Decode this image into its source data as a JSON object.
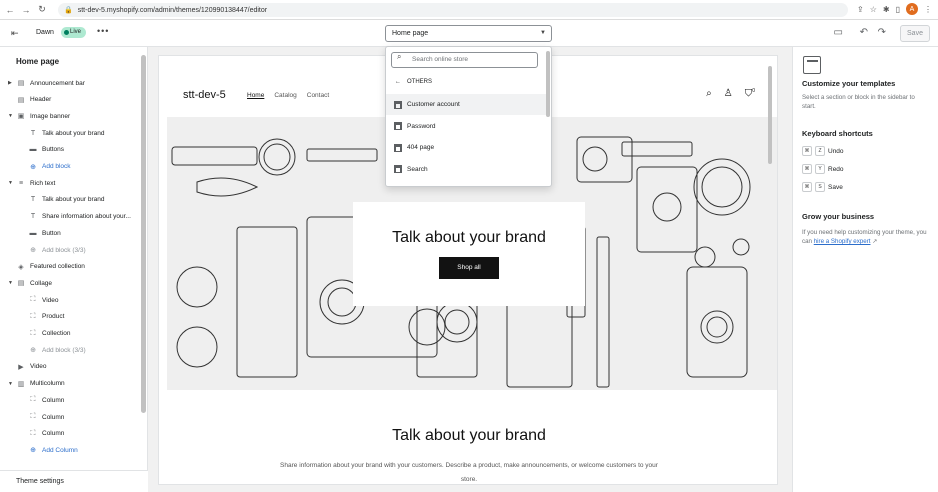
{
  "browser": {
    "url": "stt-dev-5.myshopify.com/admin/themes/120990138447/editor",
    "profile_initial": "A"
  },
  "toolbar": {
    "theme_name": "Dawn",
    "live_label": "Live",
    "page_selector": "Home page",
    "save_label": "Save"
  },
  "sidebar": {
    "title": "Home page",
    "items": [
      {
        "label": "Announcement bar",
        "icon": "section-icon",
        "level": 0,
        "arrow": "▶",
        "kind": "section"
      },
      {
        "label": "Header",
        "icon": "section-icon",
        "level": 0,
        "arrow": "",
        "kind": "section"
      },
      {
        "label": "Image banner",
        "icon": "image-icon",
        "level": 0,
        "arrow": "▼",
        "kind": "section"
      },
      {
        "label": "Talk about your brand",
        "icon": "text-icon",
        "level": 1,
        "arrow": "",
        "kind": "block"
      },
      {
        "label": "Buttons",
        "icon": "buttons-icon",
        "level": 1,
        "arrow": "",
        "kind": "block"
      },
      {
        "label": "Add block",
        "icon": "plus-icon",
        "level": 1,
        "arrow": "",
        "kind": "add"
      },
      {
        "label": "Rich text",
        "icon": "richtext-icon",
        "level": 0,
        "arrow": "▼",
        "kind": "section"
      },
      {
        "label": "Talk about your brand",
        "icon": "text-icon",
        "level": 1,
        "arrow": "",
        "kind": "block"
      },
      {
        "label": "Share information about your...",
        "icon": "text-icon",
        "level": 1,
        "arrow": "",
        "kind": "block"
      },
      {
        "label": "Button",
        "icon": "buttons-icon",
        "level": 1,
        "arrow": "",
        "kind": "block"
      },
      {
        "label": "Add block (3/3)",
        "icon": "plus-icon",
        "level": 1,
        "arrow": "",
        "kind": "disabled"
      },
      {
        "label": "Featured collection",
        "icon": "tag-icon",
        "level": 0,
        "arrow": "",
        "kind": "section"
      },
      {
        "label": "Collage",
        "icon": "section-icon",
        "level": 0,
        "arrow": "▼",
        "kind": "section"
      },
      {
        "label": "Video",
        "icon": "frame-icon",
        "level": 1,
        "arrow": "",
        "kind": "block"
      },
      {
        "label": "Product",
        "icon": "frame-icon",
        "level": 1,
        "arrow": "",
        "kind": "block"
      },
      {
        "label": "Collection",
        "icon": "frame-icon",
        "level": 1,
        "arrow": "",
        "kind": "block"
      },
      {
        "label": "Add block (3/3)",
        "icon": "plus-icon",
        "level": 1,
        "arrow": "",
        "kind": "disabled"
      },
      {
        "label": "Video",
        "icon": "play-icon",
        "level": 0,
        "arrow": "",
        "kind": "section"
      },
      {
        "label": "Multicolumn",
        "icon": "columns-icon",
        "level": 0,
        "arrow": "▼",
        "kind": "section"
      },
      {
        "label": "Column",
        "icon": "frame-icon",
        "level": 1,
        "arrow": "",
        "kind": "block"
      },
      {
        "label": "Column",
        "icon": "frame-icon",
        "level": 1,
        "arrow": "",
        "kind": "block"
      },
      {
        "label": "Column",
        "icon": "frame-icon",
        "level": 1,
        "arrow": "",
        "kind": "block"
      },
      {
        "label": "Add Column",
        "icon": "plus-icon",
        "level": 1,
        "arrow": "",
        "kind": "add"
      }
    ],
    "footer": "Theme settings"
  },
  "dropdown": {
    "search_placeholder": "Search online store",
    "back_label": "OTHERS",
    "items": [
      "Customer account",
      "Password",
      "404 page",
      "Search"
    ]
  },
  "preview": {
    "store_name": "stt-dev-5",
    "nav": [
      "Home",
      "Catalog",
      "Contact"
    ],
    "cart_count": "0",
    "hero_heading": "Talk about your brand",
    "hero_button": "Shop all",
    "rich_heading": "Talk about your brand",
    "rich_text": "Share information about your brand with your customers. Describe a product, make announcements, or welcome customers to your store."
  },
  "right_panel": {
    "heading": "Customize your templates",
    "description": "Select a section or block in the sidebar to start.",
    "shortcuts_heading": "Keyboard shortcuts",
    "shortcuts": [
      {
        "key": "Z",
        "label": "Undo"
      },
      {
        "key": "Y",
        "label": "Redo"
      },
      {
        "key": "S",
        "label": "Save"
      }
    ],
    "grow_heading": "Grow your business",
    "grow_text": "If you need help customizing your theme, you can",
    "grow_link": "hire a Shopify expert"
  },
  "colors": {
    "accent": "#2c6ecb",
    "live_badge": "#aee9d1",
    "hero_bg": "#efefef"
  }
}
